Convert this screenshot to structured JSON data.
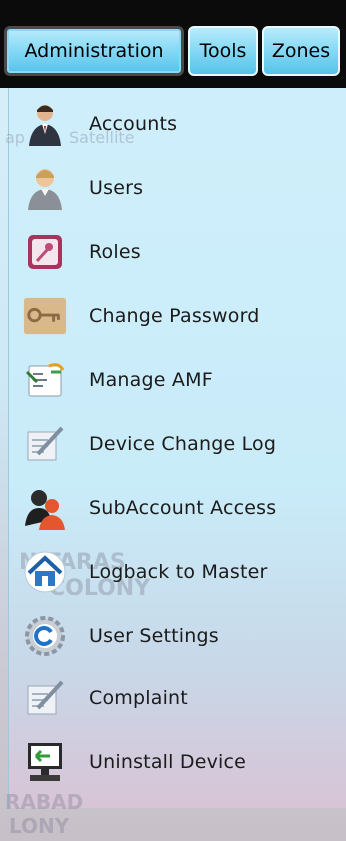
{
  "tabs": [
    {
      "label": "Administration"
    },
    {
      "label": "Tools"
    },
    {
      "label": "Zones"
    }
  ],
  "menu": {
    "items": [
      {
        "label": "Accounts",
        "icon": "accounts-icon"
      },
      {
        "label": "Users",
        "icon": "users-icon"
      },
      {
        "label": "Roles",
        "icon": "roles-icon"
      },
      {
        "label": "Change Password",
        "icon": "key-icon"
      },
      {
        "label": "Manage AMF",
        "icon": "manage-amf-icon"
      },
      {
        "label": "Device Change Log",
        "icon": "change-log-icon"
      },
      {
        "label": "SubAccount Access",
        "icon": "subaccount-icon"
      },
      {
        "label": "Logback to Master",
        "icon": "home-icon"
      },
      {
        "label": "User Settings",
        "icon": "gear-icon"
      },
      {
        "label": "Complaint",
        "icon": "complaint-icon"
      },
      {
        "label": "Uninstall Device",
        "icon": "uninstall-device-icon"
      }
    ]
  },
  "map_background": {
    "labels": [
      "ap",
      "Satellite",
      "NITARAS",
      "COLONY",
      "RABAD",
      "LONY"
    ]
  }
}
